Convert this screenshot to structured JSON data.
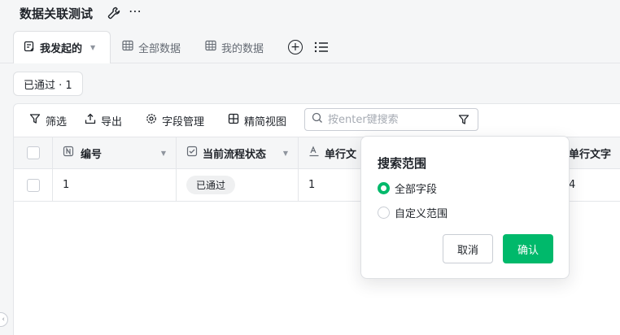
{
  "app": {
    "title": "数据关联测试"
  },
  "tabs": [
    {
      "label": "我发起的",
      "active": true
    },
    {
      "label": "全部数据"
    },
    {
      "label": "我的数据"
    }
  ],
  "filter_chip": "已通过 · 1",
  "toolbar": {
    "filter": "筛选",
    "export": "导出",
    "fields": "字段管理",
    "compact_view": "精简视图",
    "search_placeholder": "按enter键搜索"
  },
  "table": {
    "columns": [
      "编号",
      "当前流程状态",
      "单行文",
      "单行文字"
    ],
    "rows": [
      {
        "id": "1",
        "status": "已通过",
        "text1": "1",
        "text2": "4"
      }
    ]
  },
  "search_popover": {
    "title": "搜索范围",
    "options": [
      {
        "label": "全部字段",
        "selected": true
      },
      {
        "label": "自定义范围",
        "selected": false
      }
    ],
    "cancel": "取消",
    "confirm": "确认"
  },
  "colors": {
    "accent": "#00b96b",
    "border": "#dee0e3",
    "text": "#1f2329"
  }
}
